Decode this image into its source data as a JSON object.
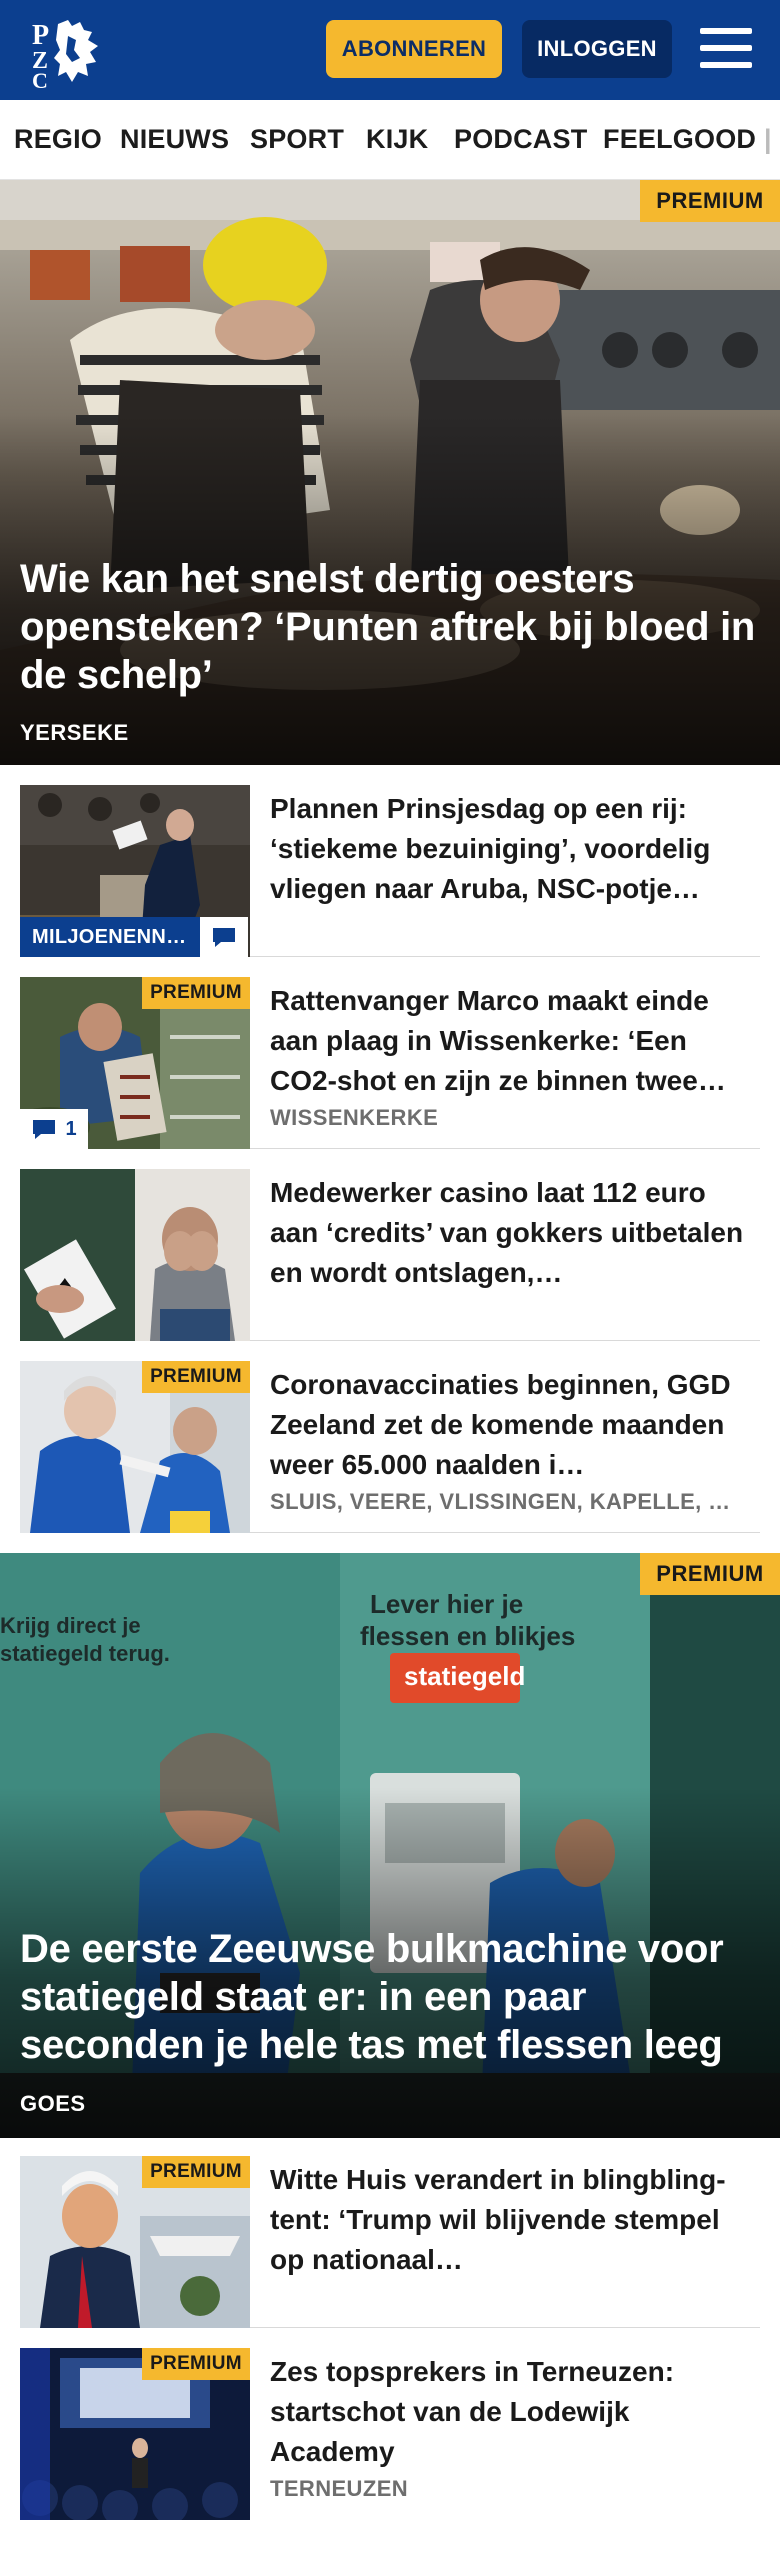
{
  "header": {
    "logo_alt": "PZC",
    "subscribe_label": "ABONNEREN",
    "login_label": "INLOGGEN",
    "menu_icon": "hamburger-menu-icon"
  },
  "nav": {
    "items": [
      "REGIO",
      "NIEUWS",
      "SPORT",
      "KIJK",
      "PODCAST",
      "FEELGOOD"
    ]
  },
  "hero1": {
    "premium": "PREMIUM",
    "title": "Wie kan het snelst dertig oesters opensteken? ‘Punten aftrek bij bloed in de schelp’",
    "location": "YERSEKE"
  },
  "articles": [
    {
      "title": "Plannen Prinsjesdag op een rij: ‘stiekeme bezuiniging’, voordelig vliegen naar Aruba, NSC-potje…",
      "category": "MILJOENENN…",
      "comment_icon": "comment-icon"
    },
    {
      "premium": "PREMIUM",
      "title": "Rattenvanger Marco maakt einde aan plaag in Wissenkerke: ‘Een CO2-shot en zijn ze binnen twee…",
      "location": "WISSENKERKE",
      "comments": "1",
      "comment_icon": "comment-icon"
    },
    {
      "title": "Medewerker casino laat 112 euro aan ‘credits’ van gokkers uitbetalen en wordt ontslagen,…"
    },
    {
      "premium": "PREMIUM",
      "title": "Coronavaccinaties beginnen, GGD Zeeland zet de komende maanden weer 65.000 naalden i…",
      "location": "SLUIS, VEERE, VLISSINGEN, KAPELLE, …"
    }
  ],
  "hero2": {
    "premium": "PREMIUM",
    "title": "De eerste Zeeuwse bulkmachine voor statiegeld staat er: in een paar seconden je hele tas met flessen leeg",
    "location": "GOES"
  },
  "articles2": [
    {
      "premium": "PREMIUM",
      "title": "Witte Huis verandert in blingbling-tent: ‘Trump wil blijvende stempel op nationaal…"
    },
    {
      "premium": "PREMIUM",
      "title": "Zes topsprekers in Terneuzen: startschot van de Lodewijk Academy",
      "location": "TERNEUZEN"
    }
  ],
  "colors": {
    "brand_blue": "#0c3f8f",
    "premium_yellow": "#f5b82e",
    "location_gray": "#6e6e6e"
  }
}
